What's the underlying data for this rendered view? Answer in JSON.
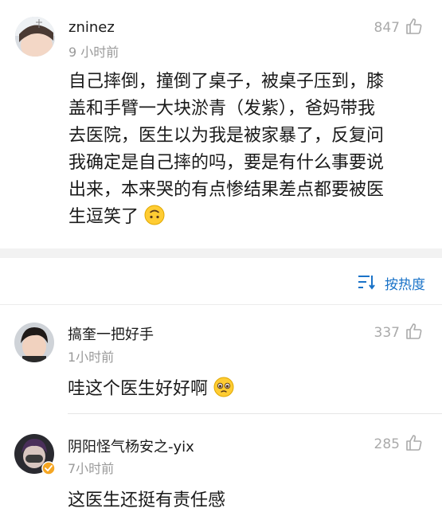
{
  "post": {
    "author": "zninez",
    "time": "9 小时前",
    "likes": "847",
    "lines": [
      "自己摔倒，撞倒了桌子，被桌子压到，膝",
      "盖和手臂一大块淤青（发紫），爸妈带我",
      "去医院，医生以为我是被家暴了，反复问",
      "我确定是自己摔的吗，要是有什么事要说",
      "出来，本来哭的有点惨结果差点都要被医",
      "生逗笑了"
    ],
    "emoji": "upside-down-face"
  },
  "sort": {
    "label": "按热度",
    "icon": "sort-icon"
  },
  "comments": [
    {
      "author": "搞奎一把好手",
      "time": "1小时前",
      "likes": "337",
      "text": "哇这个医生好好啊",
      "emoji": "pleading-face"
    },
    {
      "author": "阴阳怪气杨安之-yix",
      "time": "7小时前",
      "likes": "285",
      "text": "这医生还挺有责任感",
      "badge": "verified-badge"
    }
  ],
  "colors": {
    "accent": "#1a73c8",
    "secondary_text": "#9a9a9a",
    "separator": "#f2f2f2"
  }
}
